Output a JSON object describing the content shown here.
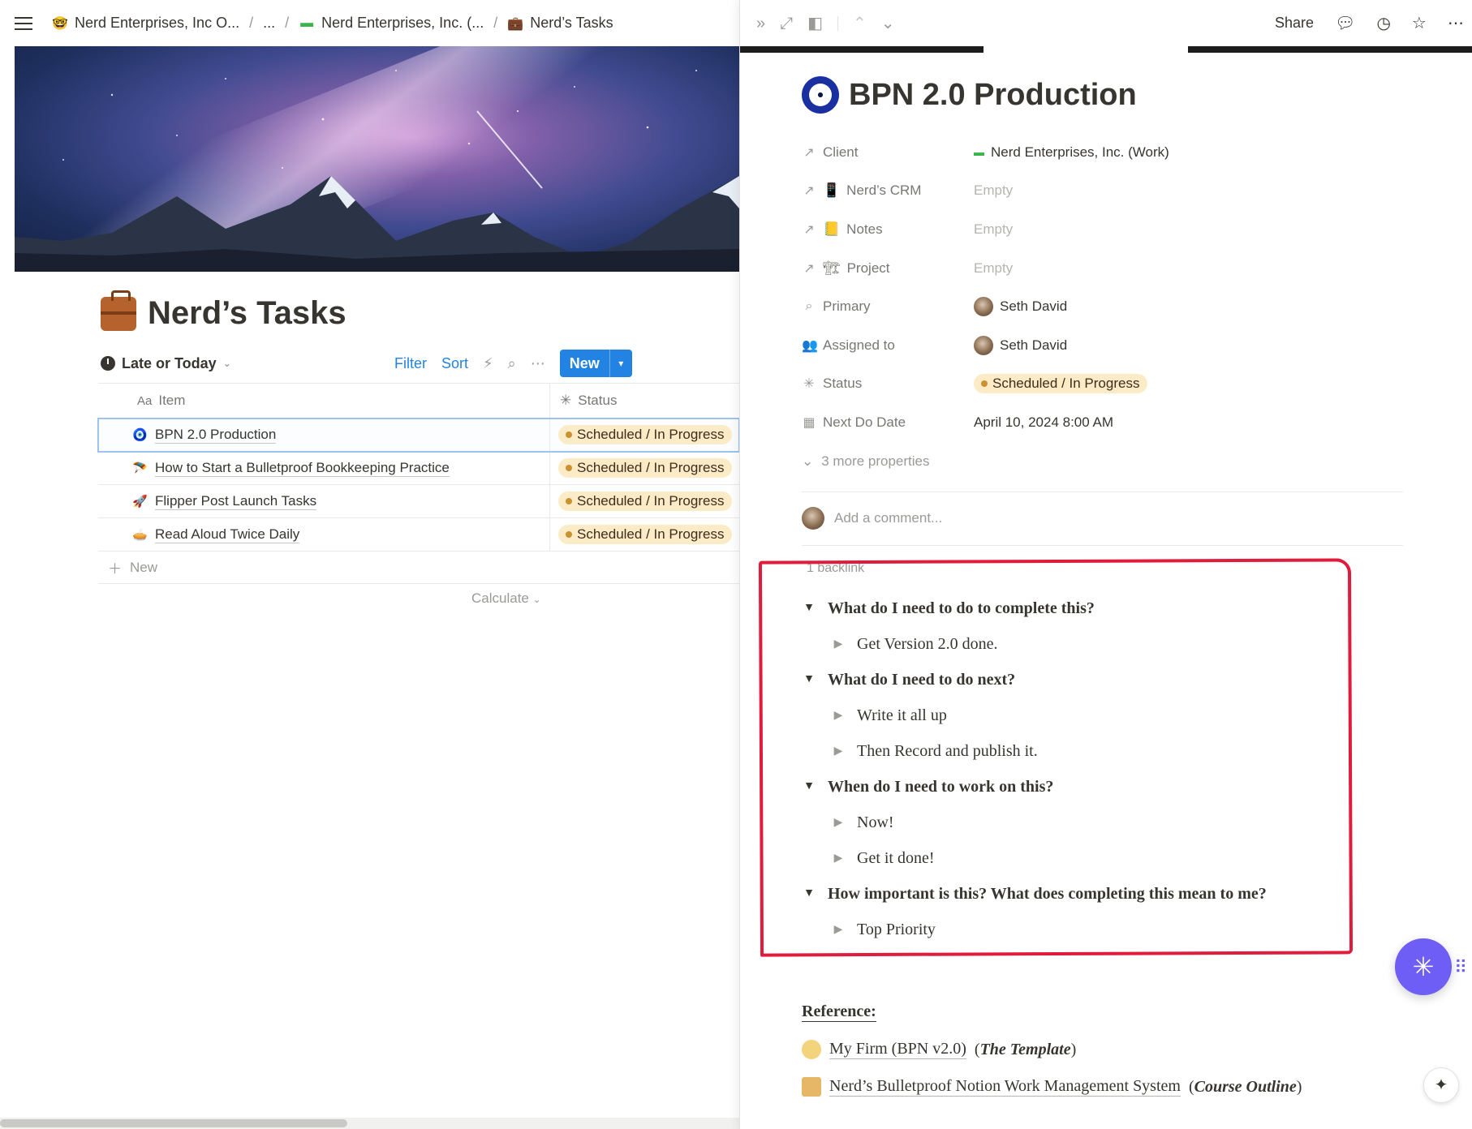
{
  "breadcrumb": {
    "items": [
      {
        "icon": "nerd-face-icon",
        "glyph": "🤓",
        "label": "Nerd Enterprises, Inc O..."
      },
      {
        "icon": "",
        "glyph": "",
        "label": "..."
      },
      {
        "icon": "green-logo-icon",
        "glyph": "▬",
        "label": "Nerd Enterprises, Inc. (..."
      },
      {
        "icon": "briefcase-icon",
        "glyph": "💼",
        "label": "Nerd’s Tasks"
      }
    ],
    "separator": "/"
  },
  "page": {
    "title": "Nerd’s Tasks"
  },
  "toolbar": {
    "view_label": "Late or Today",
    "filter": "Filter",
    "sort": "Sort",
    "new": "New"
  },
  "table": {
    "headers": {
      "item_prefix": "Aa",
      "item": "Item",
      "status": "Status"
    },
    "rows": [
      {
        "icon": "evil-eye-icon",
        "glyph": "🧿",
        "item": "BPN 2.0 Production",
        "status": "Scheduled / In Progress"
      },
      {
        "icon": "parachute-icon",
        "glyph": "🪂",
        "item": "How to Start a Bulletproof Bookkeeping Practice",
        "status": "Scheduled / In Progress"
      },
      {
        "icon": "rocket-icon",
        "glyph": "🚀",
        "item": "Flipper Post Launch Tasks",
        "status": "Scheduled / In Progress"
      },
      {
        "icon": "pie-icon",
        "glyph": "🥧",
        "item": "Read Aloud Twice Daily",
        "status": "Scheduled / In Progress"
      }
    ],
    "add_new": "New",
    "calculate": "Calculate"
  },
  "peek": {
    "share": "Share",
    "title": "BPN 2.0 Production",
    "properties": [
      {
        "icon": "relation-arrow-icon",
        "glyph": "↗",
        "label_icon": "",
        "label": "Client",
        "value": "Nerd Enterprises, Inc. (Work)",
        "value_icon": "green-logo-icon",
        "empty": false
      },
      {
        "icon": "relation-arrow-icon",
        "glyph": "↗",
        "label_icon": "📱",
        "label": "Nerd’s CRM",
        "value": "Empty",
        "value_icon": "",
        "empty": true
      },
      {
        "icon": "relation-arrow-icon",
        "glyph": "↗",
        "label_icon": "📒",
        "label": "Notes",
        "value": "Empty",
        "value_icon": "",
        "empty": true
      },
      {
        "icon": "relation-arrow-icon",
        "glyph": "↗",
        "label_icon": "🏗",
        "label": "Project",
        "value": "Empty",
        "value_icon": "",
        "empty": true
      },
      {
        "icon": "search-icon",
        "glyph": "⌕",
        "label_icon": "",
        "label": "Primary",
        "value": "Seth David",
        "value_icon": "avatar",
        "empty": false
      },
      {
        "icon": "people-icon",
        "glyph": "👥",
        "label_icon": "",
        "label": "Assigned to",
        "value": "Seth David",
        "value_icon": "avatar",
        "empty": false
      },
      {
        "icon": "status-spinner-icon",
        "glyph": "✳",
        "label_icon": "",
        "label": "Status",
        "value": "Scheduled / In Progress",
        "value_icon": "pill",
        "empty": false
      },
      {
        "icon": "calendar-icon",
        "glyph": "▦",
        "label_icon": "",
        "label": "Next Do Date",
        "value": "April 10, 2024 8:00 AM",
        "value_icon": "",
        "empty": false
      }
    ],
    "more_properties": "3 more properties",
    "comment_placeholder": "Add a comment...",
    "backlink": "1 backlink",
    "toggles": [
      {
        "heading": "What do I need to do to complete this?",
        "children": [
          "Get Version 2.0 done."
        ]
      },
      {
        "heading": "What do I need to do next?",
        "children": [
          "Write it all up",
          "Then Record and publish it."
        ]
      },
      {
        "heading": "When do I need to work on this?",
        "children": [
          "Now!",
          "Get it done!"
        ]
      },
      {
        "heading": "How important is this? What does completing this mean to me?",
        "children": [
          "Top Priority"
        ]
      }
    ],
    "reference_heading": "Reference:",
    "references": [
      {
        "link": "My Firm (BPN v2.0)",
        "note": "The Template"
      },
      {
        "link": "Nerd’s Bulletproof Notion Work Management System",
        "note": "Course Outline"
      }
    ]
  },
  "colors": {
    "accent": "#2383e2",
    "status_bg": "#fbecc7",
    "status_dot": "#cb912f",
    "annotation": "#e01b3c",
    "fab": "#6f5ef5"
  }
}
